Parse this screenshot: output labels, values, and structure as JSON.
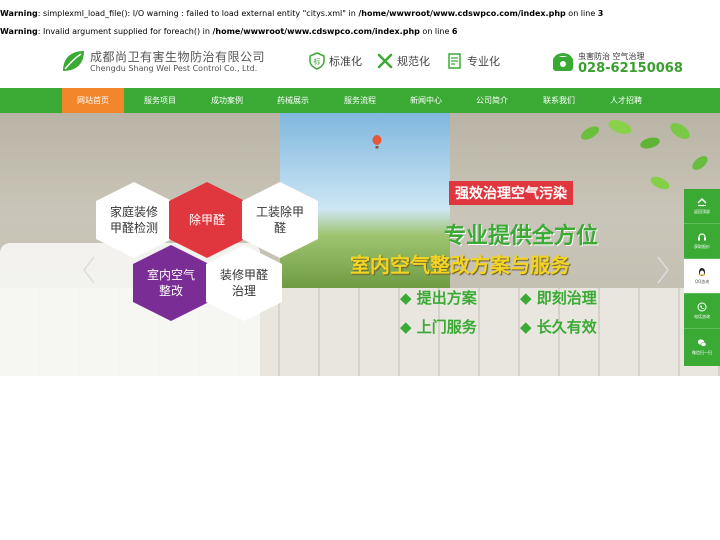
{
  "warnings": [
    {
      "label": "Warning",
      "msg": ": simplexml_load_file(): I/O warning : failed to load external entity \"citys.xml\" in ",
      "path": "/home/wwwroot/www.cdswpco.com/index.php",
      "tail": " on line ",
      "line": "3"
    },
    {
      "label": "Warning",
      "msg": ": Invalid argument supplied for foreach() in ",
      "path": "/home/wwwroot/www.cdswpco.com/index.php",
      "tail": " on line ",
      "line": "6"
    }
  ],
  "header": {
    "company_cn": "成都尚卫有害生物防治有限公司",
    "company_en": "Chengdu Shang Wei Pest Control Co., Ltd.",
    "badges": [
      "标准化",
      "规范化",
      "专业化"
    ],
    "phone_tag": "虫害防治  空气治理",
    "phone": "028-62150068"
  },
  "nav": {
    "items": [
      "网站首页",
      "服务项目",
      "成功案例",
      "药械展示",
      "服务流程",
      "新闻中心",
      "公司简介",
      "联系我们",
      "人才招聘"
    ]
  },
  "banner": {
    "hexes": [
      {
        "text": "家庭装修甲醛检测",
        "color": "#ffffff",
        "fg": "#333"
      },
      {
        "text": "除甲醛",
        "color": "#e0373f",
        "fg": "#fff"
      },
      {
        "text": "工装除甲醛",
        "color": "#ffffff",
        "fg": "#333"
      },
      {
        "text": "室内空气整改",
        "color": "#7b2d96",
        "fg": "#fff"
      },
      {
        "text": "装修甲醛治理",
        "color": "#ffffff",
        "fg": "#333"
      }
    ],
    "tag": "强效治理空气污染",
    "line1": "专业提供全方位",
    "line2": "室内空气整改方案与服务",
    "points": [
      "◆ 提出方案",
      "◆ 即刻治理",
      "◆ 上门服务",
      "◆ 长久有效"
    ]
  },
  "sidebar": {
    "items": [
      "返回顶部",
      "获取报价",
      "QQ咨询",
      "电话咨询",
      "微信扫一扫"
    ]
  },
  "colors": {
    "brand_green": "#3aaa35",
    "nav_active": "#f3852b",
    "hex_red": "#e0373f",
    "hex_purple": "#7b2d96"
  }
}
